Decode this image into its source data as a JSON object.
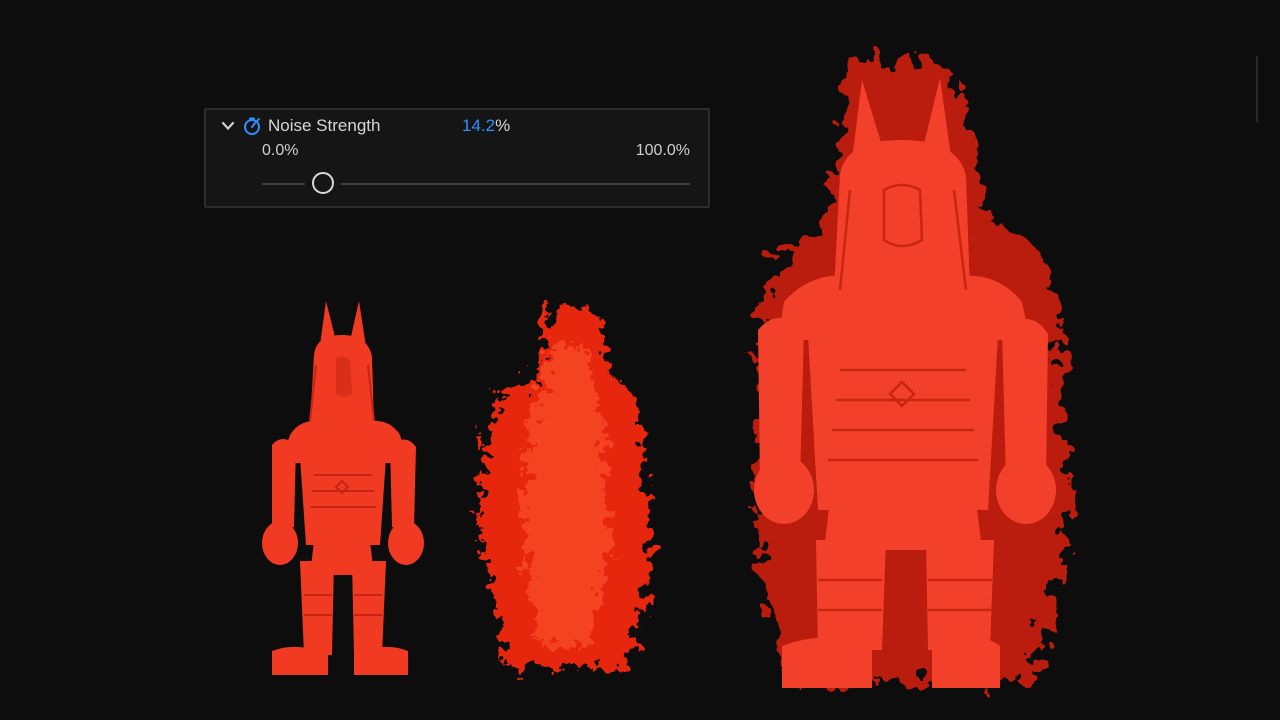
{
  "param": {
    "name": "Noise Strength",
    "value_num": "14.2",
    "value_unit": "%",
    "min": "0.0%",
    "max": "100.0%",
    "fraction": 0.142
  },
  "colors": {
    "accent": "#2f8fff",
    "figure": "#f03a22",
    "particles": "#ff2a10"
  },
  "icons": {
    "expand": "chevron-down-icon",
    "keyframe": "stopwatch-icon"
  }
}
